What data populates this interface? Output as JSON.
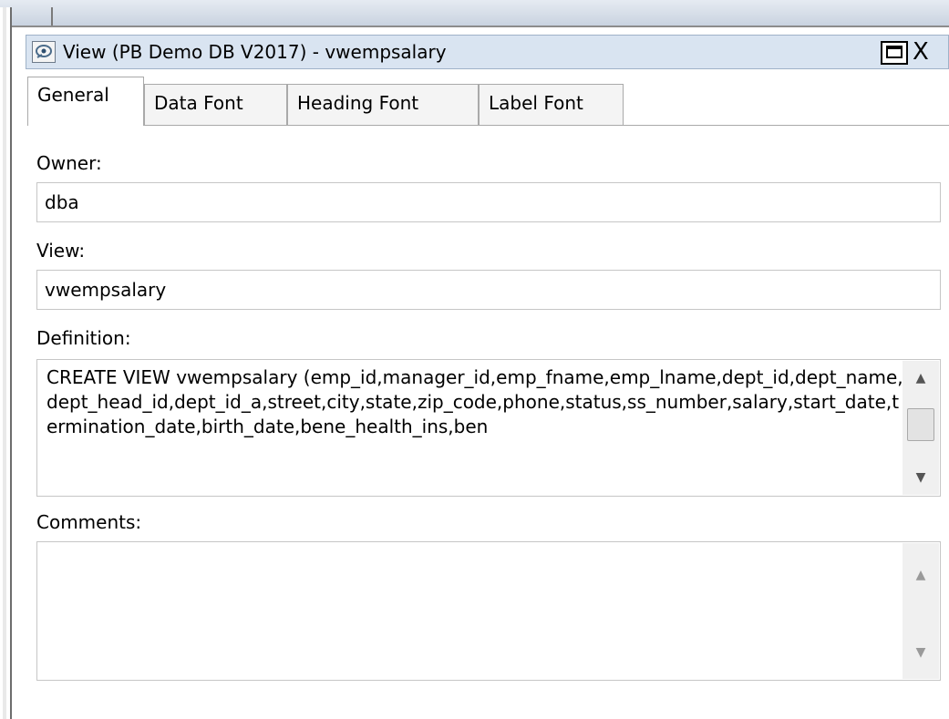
{
  "window": {
    "title": "View (PB Demo DB V2017) - vwempsalary",
    "maximize_label": "",
    "close_label": "X"
  },
  "tabs": [
    {
      "label": "General",
      "active": true
    },
    {
      "label": "Data Font",
      "active": false
    },
    {
      "label": "Heading Font",
      "active": false
    },
    {
      "label": "Label Font",
      "active": false
    }
  ],
  "form": {
    "owner_label": "Owner:",
    "owner_value": "dba",
    "view_label": "View:",
    "view_value": "vwempsalary",
    "definition_label": "Definition:",
    "definition_value": "CREATE VIEW vwempsalary (emp_id,manager_id,emp_fname,emp_lname,dept_id,dept_name,dept_head_id,dept_id_a,street,city,state,zip_code,phone,status,ss_number,salary,start_date,termination_date,birth_date,bene_health_ins,ben",
    "comments_label": "Comments:",
    "comments_value": ""
  },
  "scroll": {
    "up_glyph": "▲",
    "down_glyph": "▼"
  },
  "icons": [
    "view-icon",
    "maximize-icon",
    "close-icon",
    "scroll-up-icon",
    "scroll-down-icon"
  ]
}
